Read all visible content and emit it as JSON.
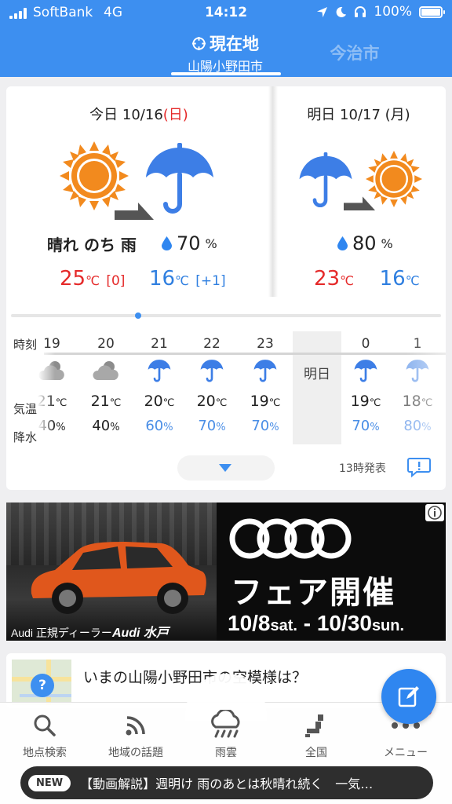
{
  "status_bar": {
    "carrier": "SoftBank",
    "network": "4G",
    "time": "14:12",
    "battery": "100%"
  },
  "locations": {
    "current_label": "現在地",
    "current_city": "山陽小野田市",
    "other": "今治市"
  },
  "today": {
    "date_prefix": "今日 10/16",
    "weekday": "(日)",
    "weather_text": "晴れ のち 雨",
    "precip_value": "70",
    "precip_unit": "%",
    "high": "25",
    "high_diff": "[0]",
    "low": "16",
    "low_diff": "[+1]",
    "temp_unit": "℃",
    "icons": [
      "sun-icon",
      "arrow-icon",
      "umbrella-icon"
    ]
  },
  "tomorrow": {
    "date": "明日 10/17 (月)",
    "precip_value": "80",
    "precip_unit": "%",
    "high": "23",
    "low": "16",
    "temp_unit": "℃",
    "icons": [
      "umbrella-icon",
      "arrow-icon",
      "sun-icon"
    ]
  },
  "hourly": {
    "labels": {
      "hour": "時刻",
      "temp": "気温",
      "precip": "降水"
    },
    "next_day_label": "明日",
    "items": [
      {
        "hour": "19",
        "icon": "cloud-icon",
        "temp": "21",
        "precip": "40"
      },
      {
        "hour": "20",
        "icon": "cloud-icon",
        "temp": "21",
        "precip": "40"
      },
      {
        "hour": "21",
        "icon": "umbrella-icon",
        "temp": "20",
        "precip": "60"
      },
      {
        "hour": "22",
        "icon": "umbrella-icon",
        "temp": "20",
        "precip": "70"
      },
      {
        "hour": "23",
        "icon": "umbrella-icon",
        "temp": "19",
        "precip": "70"
      },
      {
        "hour": "0",
        "icon": "umbrella-icon",
        "temp": "19",
        "precip": "70"
      },
      {
        "hour": "1",
        "icon": "umbrella-icon",
        "temp": "18",
        "precip": "80"
      }
    ],
    "temp_unit": "℃",
    "precip_unit": "%",
    "issued": "13時発表"
  },
  "ad": {
    "dealer_prefix": "Audi 正規ディーラー",
    "dealer_name": "Audi 水戸",
    "fair": "フェア開催",
    "dates_start": "10/8",
    "start_day": "sat.",
    "dates_sep": "-",
    "dates_end": "10/30",
    "end_day": "sun."
  },
  "news_card": {
    "title": "いまの山陽小野田市の空模様は？",
    "map_pin": "?"
  },
  "nav": {
    "items": [
      {
        "label": "地点検索",
        "icon": "search-icon"
      },
      {
        "label": "地域の話題",
        "icon": "feed-icon"
      },
      {
        "label": "雨雲",
        "icon": "rain-cloud-icon"
      },
      {
        "label": "全国",
        "icon": "japan-map-icon"
      },
      {
        "label": "メニュー",
        "icon": "more-icon"
      }
    ]
  },
  "ticker": {
    "badge": "NEW",
    "text": "【動画解説】週明け 雨のあとは秋晴れ続く　一気…"
  },
  "colors": {
    "header": "#3d8ff0",
    "red": "#e52a2a",
    "blue": "#2f7fe0",
    "sun": "#f28a1e"
  }
}
